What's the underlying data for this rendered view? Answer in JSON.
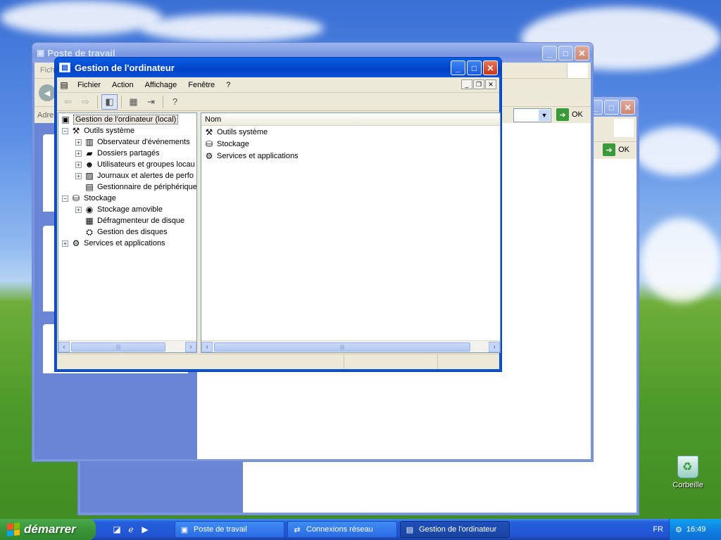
{
  "desktop": {
    "recycle_bin": "Corbeille"
  },
  "bg_windows": {
    "poste": {
      "title": "Poste de travail",
      "menu_first": "Fich",
      "address": "Adre"
    },
    "reseau": {
      "ok": "OK"
    },
    "poste_go": "OK"
  },
  "window": {
    "title": "Gestion de l'ordinateur",
    "menu": [
      "Fichier",
      "Action",
      "Affichage",
      "Fenêtre",
      "?"
    ],
    "tree": [
      {
        "label": "Gestion de l'ordinateur (local)",
        "icon": "computer-icon",
        "level": 0,
        "expander": ""
      },
      {
        "label": "Outils système",
        "icon": "tools-icon",
        "level": 1,
        "expander": "−"
      },
      {
        "label": "Observateur d'événements",
        "icon": "event-viewer-icon",
        "level": 2,
        "expander": "+"
      },
      {
        "label": "Dossiers partagés",
        "icon": "shared-folder-icon",
        "level": 2,
        "expander": "+"
      },
      {
        "label": "Utilisateurs et groupes locau",
        "icon": "users-icon",
        "level": 2,
        "expander": "+"
      },
      {
        "label": "Journaux et alertes de perfo",
        "icon": "perf-logs-icon",
        "level": 2,
        "expander": "+"
      },
      {
        "label": "Gestionnaire de périphérique",
        "icon": "device-manager-icon",
        "level": 2,
        "expander": ""
      },
      {
        "label": "Stockage",
        "icon": "storage-icon",
        "level": 1,
        "expander": "−"
      },
      {
        "label": "Stockage amovible",
        "icon": "removable-storage-icon",
        "level": 2,
        "expander": "+"
      },
      {
        "label": "Défragmenteur de disque",
        "icon": "defrag-icon",
        "level": 2,
        "expander": ""
      },
      {
        "label": "Gestion des disques",
        "icon": "disk-management-icon",
        "level": 2,
        "expander": ""
      },
      {
        "label": "Services et applications",
        "icon": "services-icon",
        "level": 1,
        "expander": "+"
      }
    ],
    "list_header": "Nom",
    "list": [
      {
        "label": "Outils système",
        "icon": "tools-icon"
      },
      {
        "label": "Stockage",
        "icon": "storage-icon"
      },
      {
        "label": "Services et applications",
        "icon": "services-icon"
      }
    ]
  },
  "taskbar": {
    "start": "démarrer",
    "tasks": [
      {
        "label": "Poste de travail",
        "icon": "my-computer-icon"
      },
      {
        "label": "Connexions réseau",
        "icon": "network-icon"
      },
      {
        "label": "Gestion de l'ordinateur",
        "icon": "computer-management-icon"
      }
    ],
    "lang": "FR",
    "clock": "16:49"
  }
}
